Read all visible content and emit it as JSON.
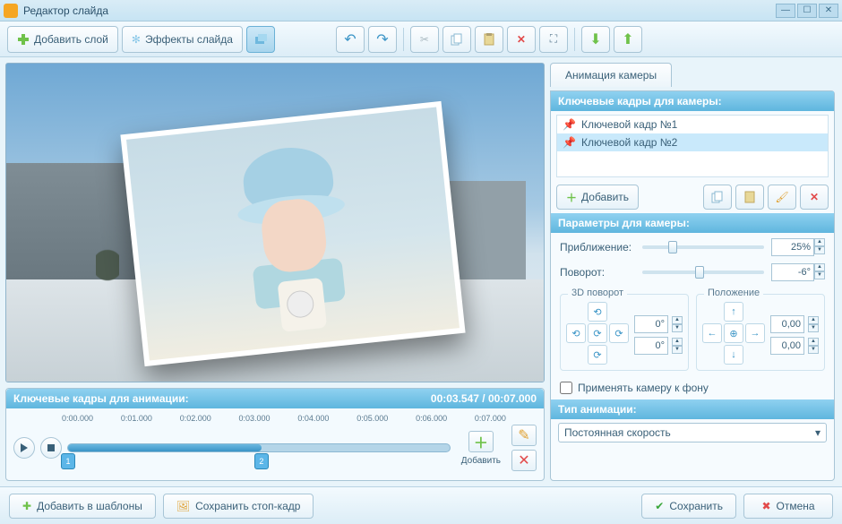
{
  "window": {
    "title": "Редактор слайда"
  },
  "toolbar": {
    "add_layer": "Добавить слой",
    "slide_effects": "Эффекты слайда"
  },
  "tabs": {
    "camera_animation": "Анимация камеры"
  },
  "keyframes_panel": {
    "heading": "Ключевые кадры для камеры:",
    "items": [
      {
        "label": "Ключевой кадр №1",
        "selected": false
      },
      {
        "label": "Ключевой кадр №2",
        "selected": true
      }
    ],
    "add_btn": "Добавить"
  },
  "camera_params": {
    "heading": "Параметры для камеры:",
    "zoom_label": "Приближение:",
    "zoom_value": "25%",
    "zoom_pct": 25,
    "rotation_label": "Поворот:",
    "rotation_value": "-6°",
    "rotation_slider_pct": 47,
    "rot3d_group": "3D поворот",
    "rot3d_x": "0°",
    "rot3d_y": "0°",
    "position_group": "Положение",
    "pos_x": "0,00",
    "pos_y": "0,00",
    "apply_bg_label": "Применять камеру к фону",
    "apply_bg_checked": false
  },
  "anim_type": {
    "heading": "Тип анимации:",
    "selected": "Постоянная скорость"
  },
  "timeline": {
    "heading": "Ключевые кадры для анимации:",
    "current": "00:03.547",
    "total": "00:07.000",
    "ticks": [
      "0:00.000",
      "0:01.000",
      "0:02.000",
      "0:03.000",
      "0:04.000",
      "0:05.000",
      "0:06.000",
      "0:07.000"
    ],
    "markers": [
      {
        "num": "1",
        "pct": 0
      },
      {
        "num": "2",
        "pct": 50.7
      }
    ],
    "add_btn": "Добавить"
  },
  "footer": {
    "add_templates": "Добавить в шаблоны",
    "save_stopframe": "Сохранить стоп-кадр",
    "save": "Сохранить",
    "cancel": "Отмена"
  }
}
